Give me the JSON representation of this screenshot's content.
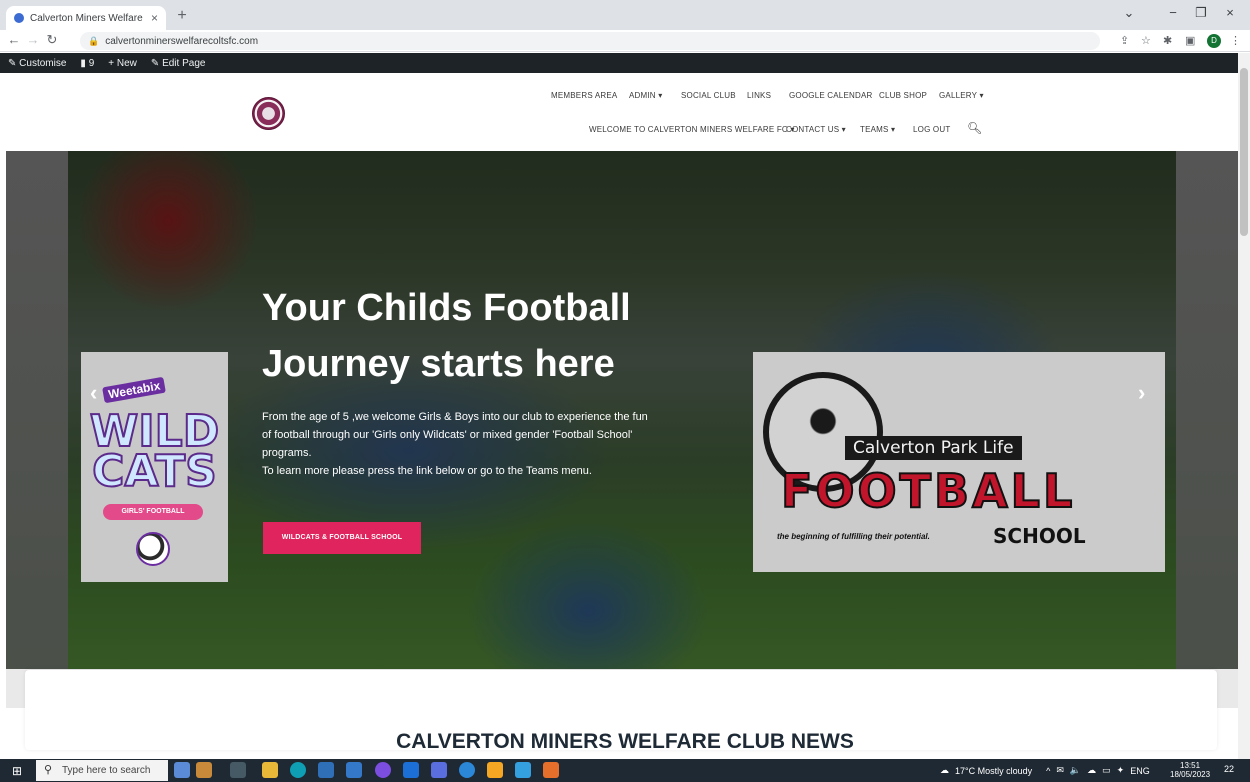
{
  "browser": {
    "tab_title": "Calverton Miners Welfare Colts F",
    "tab_close": "×",
    "new_tab": "+",
    "url": "calvertonminerswelfarecoltsfc.com",
    "profile_initial": "D",
    "win_controls": [
      "⌄",
      "−",
      "❐",
      "×"
    ]
  },
  "admin_bar": {
    "customise": "Customise",
    "comments_count": "9",
    "new": "New",
    "edit_page": "Edit Page"
  },
  "nav": {
    "row1": [
      "MEMBERS AREA",
      "ADMIN ▾",
      "SOCIAL CLUB",
      "LINKS",
      "GOOGLE CALENDAR",
      "CLUB SHOP",
      "GALLERY ▾"
    ],
    "row2": [
      "WELCOME TO CALVERTON MINERS WELFARE FC ▾",
      "CONTACT US ▾",
      "TEAMS ▾",
      "LOG OUT"
    ]
  },
  "hero": {
    "title_line1": "Your Childs Football",
    "title_line2": "Journey starts here",
    "text_line1": "From the age of 5 ,we welcome Girls & Boys into our club to experience the fun",
    "text_line2": "of football through our 'Girls only Wildcats' or mixed gender 'Football School'",
    "text_line3": "programs.",
    "text_line4": "To learn more please press the link below or go to the Teams menu.",
    "cta": "WILDCATS & FOOTBALL SCHOOL",
    "prev_arrow": "‹",
    "next_arrow": "›",
    "wildcats_card": {
      "brand": "Weetabix",
      "title": "WILD CATS",
      "subtitle": "GIRLS' FOOTBALL"
    },
    "football_card": {
      "title": "Calverton Park Life",
      "big": "FOOTBALL",
      "tagline": "the beginning of fulfilling their potential.",
      "school": "SCHOOL"
    }
  },
  "news": {
    "heading": "CALVERTON MINERS WELFARE CLUB NEWS"
  },
  "taskbar": {
    "search_placeholder": "Type here to search",
    "weather": "17°C  Mostly cloudy",
    "lang": "ENG",
    "time": "13:51",
    "date": "18/05/2023",
    "notif_count": "22"
  },
  "colors": {
    "accent": "#e0245e",
    "admin_bar": "#1d2327",
    "taskbar": "#1f2933"
  }
}
